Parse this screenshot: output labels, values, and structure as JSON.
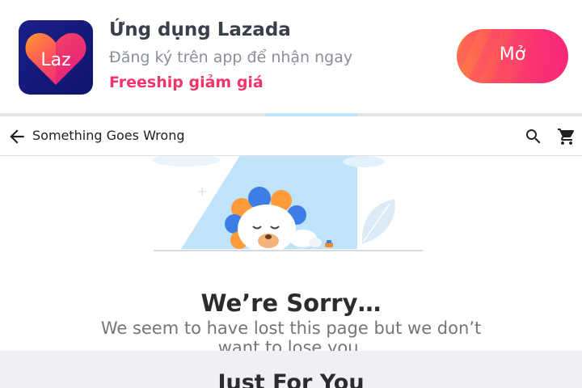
{
  "app_banner": {
    "logo_text": "Laz",
    "title": "Ứng dụng Lazada",
    "subtitle": "Đăng ký trên app để nhận ngay",
    "promo": "Freeship giảm giá",
    "open_label": "Mở"
  },
  "top_bar": {
    "title": "Something Goes Wrong",
    "icons": [
      "arrow-back-icon",
      "search-icon",
      "cart-icon"
    ]
  },
  "error": {
    "heading": "We’re Sorry…",
    "message": "We seem to have lost this page but we don’t want to lose you."
  },
  "recommendations": {
    "heading": "Just For You"
  },
  "colors": {
    "brand_pink": "#f0356b",
    "button_orange": "#ff7a45",
    "logo_navy": "#0f146b",
    "light_blue": "#bfe3fb"
  }
}
